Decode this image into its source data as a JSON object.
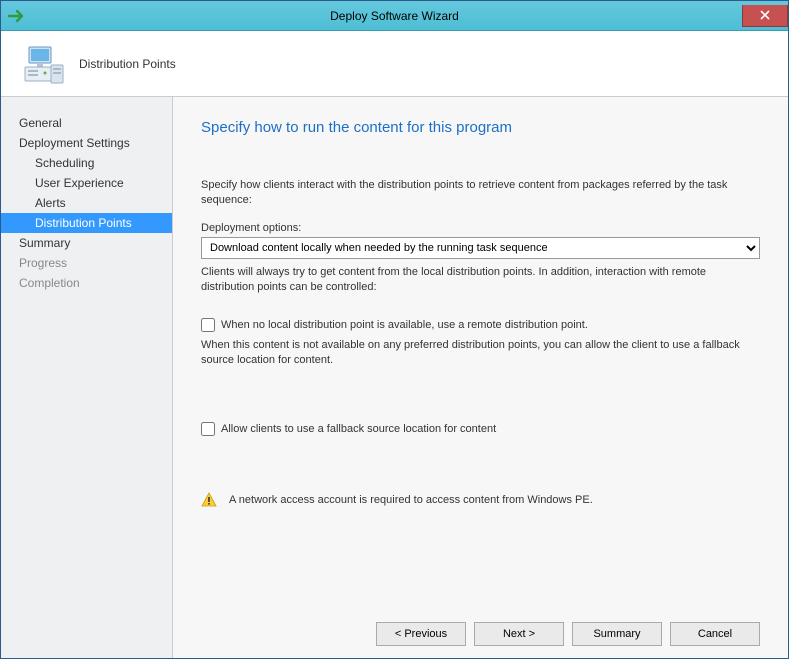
{
  "window": {
    "title": "Deploy Software Wizard"
  },
  "header": {
    "label": "Distribution Points"
  },
  "sidebar": {
    "items": [
      {
        "label": "General"
      },
      {
        "label": "Deployment Settings"
      },
      {
        "label": "Scheduling"
      },
      {
        "label": "User Experience"
      },
      {
        "label": "Alerts"
      },
      {
        "label": "Distribution Points"
      },
      {
        "label": "Summary"
      },
      {
        "label": "Progress"
      },
      {
        "label": "Completion"
      }
    ]
  },
  "content": {
    "title": "Specify how to run the content for this program",
    "intro": "Specify how clients interact with the distribution points to retrieve content from packages referred by the task sequence:",
    "options_label": "Deployment options:",
    "options_selected": "Download content locally when needed by the running task sequence",
    "hint1": "Clients will always try to get content from the local distribution points. In addition, interaction with remote distribution points can be controlled:",
    "check1_label": "When no local distribution point is available, use a remote distribution point.",
    "hint2": "When this content is not available on any preferred distribution points, you can allow the client to use a fallback source location for content.",
    "check2_label": "Allow clients to use a fallback source location for content",
    "warn": "A network access account is required to access content from Windows PE."
  },
  "buttons": {
    "previous": "< Previous",
    "next": "Next >",
    "summary": "Summary",
    "cancel": "Cancel"
  }
}
